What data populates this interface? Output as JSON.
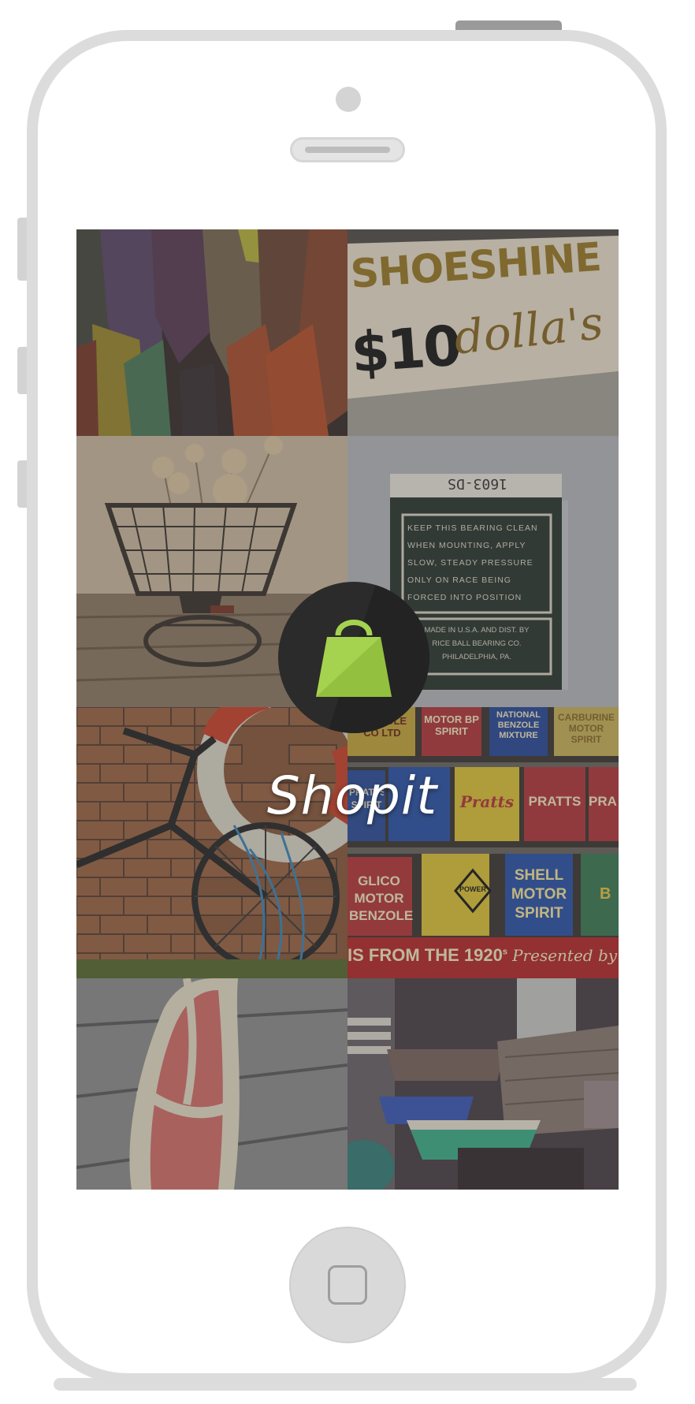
{
  "app": {
    "name": "Shopit",
    "logo_icon": "shopping-bag-icon",
    "logo_circle_color": "#2b2b2b",
    "logo_bag_color": "#a6d34f"
  },
  "tiles": {
    "shoeshine_sign": {
      "line1": "SHOESHINE",
      "line2_price": "$10",
      "line2_word": "dolla's"
    },
    "bearing_box": {
      "top_code": "1603-DS",
      "label_lines": [
        "KEEP THIS BEARING CLEAN",
        "WHEN MOUNTING, APPLY",
        "SLOW, STEADY PRESSURE",
        "ONLY ON RACE BEING",
        "FORCED INTO POSITION"
      ],
      "maker_lines": [
        "MADE IN U.S.A. AND DIST. BY",
        "RICE BALL BEARING CO.",
        "PHILADELPHIA, PA."
      ]
    },
    "oil_cans": {
      "row1": [
        "BENZOLE CO LTD",
        "MOTOR BP SPIRIT",
        "NATIONAL BENZOLE MIXTURE",
        "CARBURINE MOTOR SPIRIT"
      ],
      "row2": [
        "PRATTS SPIRIT",
        "Pratts",
        "PRATTS",
        "PRA"
      ],
      "row3": [
        "GLICO MOTOR BENZOLE",
        "POWER",
        "SHELL MOTOR SPIRIT",
        "B"
      ],
      "banner_text": "IS FROM THE 1920",
      "banner_suffix": "s",
      "banner_script": "Presented by B"
    }
  }
}
